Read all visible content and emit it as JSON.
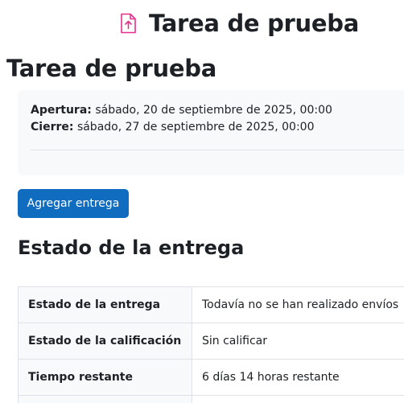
{
  "header": {
    "icon": "assignment-upload-icon",
    "icon_color": "#e62e8a",
    "title": "Tarea de prueba"
  },
  "main": {
    "title": "Tarea de prueba"
  },
  "dates": {
    "open_label": "Apertura:",
    "open_value": "sábado, 20 de septiembre de 2025, 00:00",
    "close_label": "Cierre:",
    "close_value": "sábado, 27 de septiembre de 2025, 00:00"
  },
  "actions": {
    "add_submission_label": "Agregar entrega",
    "button_color": "#0f6cbf"
  },
  "submission_status": {
    "heading": "Estado de la entrega",
    "rows": [
      {
        "label": "Estado de la entrega",
        "value": "Todavía no se han realizado envíos"
      },
      {
        "label": "Estado de la calificación",
        "value": "Sin calificar"
      },
      {
        "label": "Tiempo restante",
        "value": "6 días 14 horas restante"
      }
    ]
  }
}
